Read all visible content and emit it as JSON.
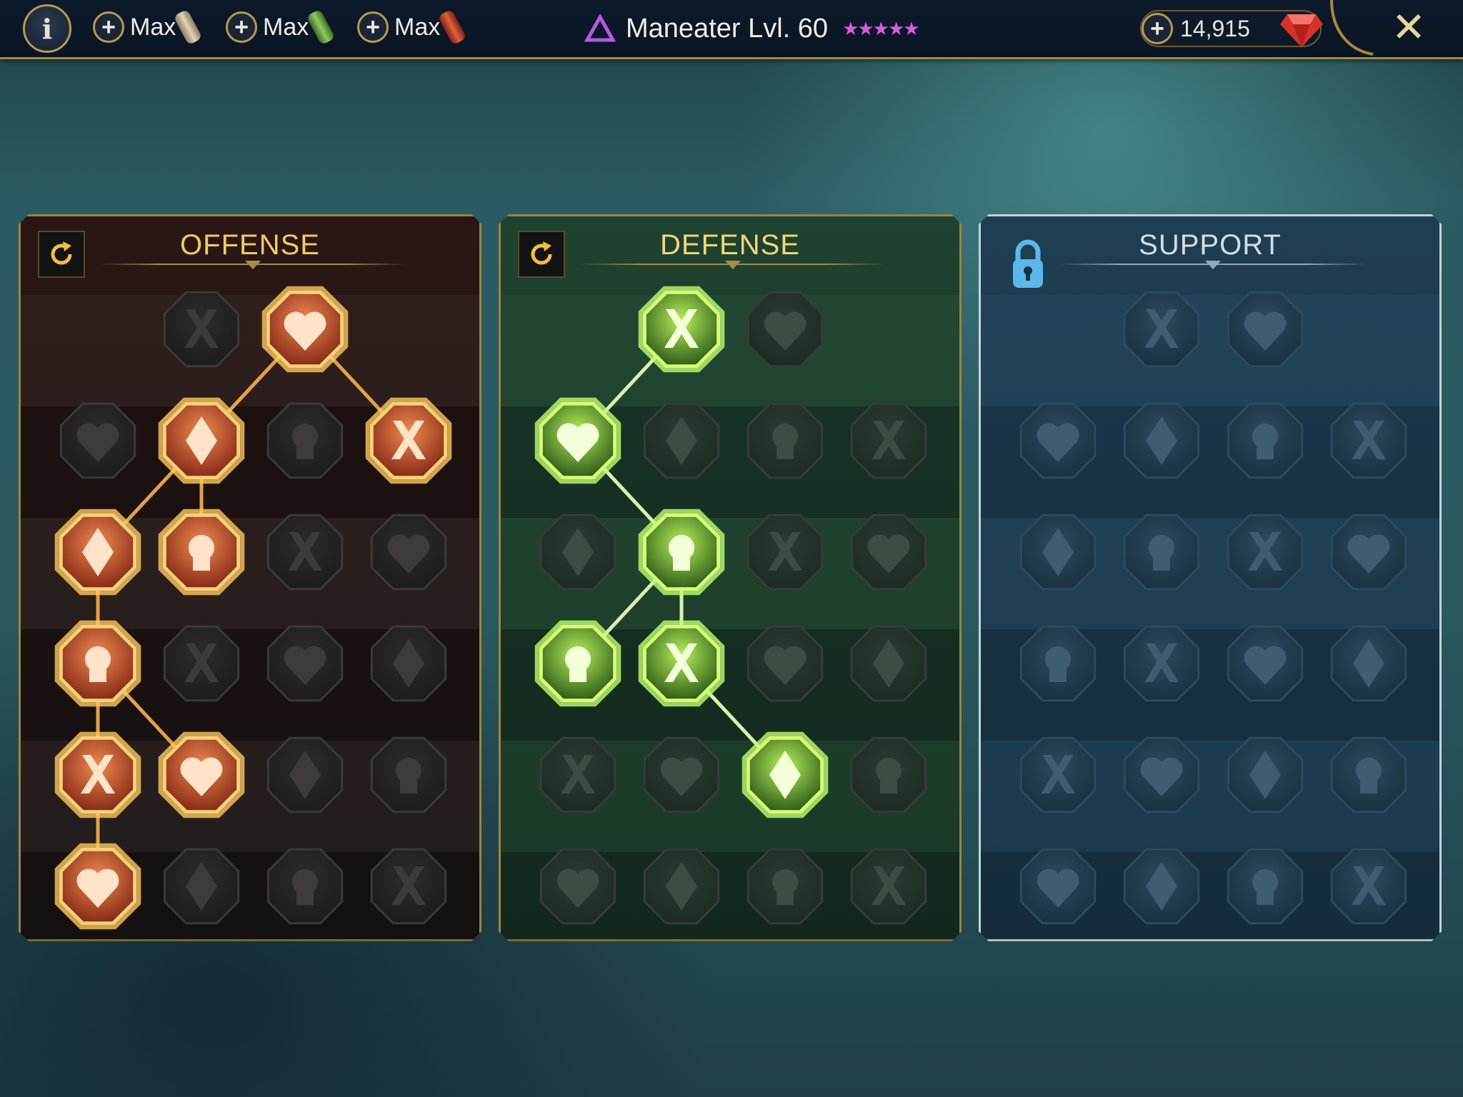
{
  "topbar": {
    "info_label": "i",
    "resources": [
      {
        "label": "Max",
        "color": "#c9b48f"
      },
      {
        "label": "Max",
        "color": "#6aa646"
      },
      {
        "label": "Max",
        "color": "#c2452d"
      }
    ],
    "champion_title": "Maneater Lvl. 60",
    "stars": "★★★★★",
    "gems": "14,915",
    "close_label": "✕"
  },
  "panels": {
    "offense": {
      "title": "OFFENSE",
      "accent": "#e0743a",
      "rows": [
        [
          {
            "icon": "crossed-swords",
            "active": false
          },
          {
            "icon": "sword-slash",
            "active": true
          }
        ],
        [
          {
            "icon": "horned-figure",
            "active": false
          },
          {
            "icon": "spear-burst",
            "active": true
          },
          {
            "icon": "shield-pierce",
            "active": false
          },
          {
            "icon": "bleeding-heart",
            "active": true
          }
        ],
        [
          {
            "icon": "arrow-volley",
            "active": true
          },
          {
            "icon": "fanged-maw",
            "active": true
          },
          {
            "icon": "skull-cloak",
            "active": false
          },
          {
            "icon": "dagger-hand",
            "active": false
          }
        ],
        [
          {
            "icon": "sword-heart",
            "active": true
          },
          {
            "icon": "fist-strike",
            "active": false
          },
          {
            "icon": "axe",
            "active": false
          },
          {
            "icon": "lightning-chain",
            "active": false
          }
        ],
        [
          {
            "icon": "triple-arrow-burst",
            "active": true
          },
          {
            "icon": "triple-skulls",
            "active": true
          },
          {
            "icon": "sword-aura",
            "active": false
          },
          {
            "icon": "flexing-figure",
            "active": false
          }
        ],
        [
          {
            "icon": "sparkling-blade",
            "active": true
          },
          {
            "icon": "knight-helm",
            "active": false
          },
          {
            "icon": "horned-demon",
            "active": false
          },
          {
            "icon": "spiked-skull",
            "active": false
          }
        ]
      ]
    },
    "defense": {
      "title": "DEFENSE",
      "accent": "#a6e03c",
      "rows": [
        [
          {
            "icon": "scale-armor",
            "active": true
          },
          {
            "icon": "raised-fist",
            "active": false
          }
        ],
        [
          {
            "icon": "chevron-shield",
            "active": true
          },
          {
            "icon": "anatomical-heart",
            "active": false
          },
          {
            "icon": "cracked-warrior",
            "active": false
          },
          {
            "icon": "crossed-blades",
            "active": false
          }
        ],
        [
          {
            "icon": "muscle-arm",
            "active": false
          },
          {
            "icon": "knight-shield",
            "active": true
          },
          {
            "icon": "skull-heart",
            "active": false
          },
          {
            "icon": "radiant-head",
            "active": false
          }
        ],
        [
          {
            "icon": "rallying-crowd",
            "active": true
          },
          {
            "icon": "skull-hourglass",
            "active": true
          },
          {
            "icon": "open-palm",
            "active": false
          },
          {
            "icon": "bull-head",
            "active": false
          }
        ],
        [
          {
            "icon": "running-figure",
            "active": false
          },
          {
            "icon": "blood-drops",
            "active": false
          },
          {
            "icon": "crowned-skull",
            "active": true
          },
          {
            "icon": "swirl-hand",
            "active": false
          }
        ],
        [
          {
            "icon": "spiked-warrior",
            "active": false
          },
          {
            "icon": "winged-shield",
            "active": false
          },
          {
            "icon": "skull-banner",
            "active": false
          },
          {
            "icon": "strongman",
            "active": false
          }
        ]
      ]
    },
    "support": {
      "title": "SUPPORT",
      "accent": "#8fb4c8",
      "rows": [
        [
          {
            "icon": "heart-plus",
            "active": false
          },
          {
            "icon": "swirl-eye",
            "active": false
          }
        ],
        [
          {
            "icon": "praying-hands",
            "active": false
          },
          {
            "icon": "shield-rings",
            "active": false
          },
          {
            "icon": "flaming-skull",
            "active": false
          },
          {
            "icon": "speed-boot",
            "active": false
          }
        ],
        [
          {
            "icon": "blessed-figure",
            "active": false
          },
          {
            "icon": "lightning-bolt",
            "active": false
          },
          {
            "icon": "broken-chain",
            "active": false
          },
          {
            "icon": "hooded-figure",
            "active": false
          }
        ],
        [
          {
            "icon": "chained-heart",
            "active": false
          },
          {
            "icon": "meteor",
            "active": false
          },
          {
            "icon": "open-book",
            "active": false
          },
          {
            "icon": "angry-eyes",
            "active": false
          }
        ],
        [
          {
            "icon": "compass-star",
            "active": false
          },
          {
            "icon": "winged-boot",
            "active": false
          },
          {
            "icon": "watchful-eye",
            "active": false
          },
          {
            "icon": "kicking-figure",
            "active": false
          }
        ],
        [
          {
            "icon": "potion-flask",
            "active": false
          },
          {
            "icon": "skull-mark",
            "active": false
          },
          {
            "icon": "fist-flames",
            "active": false
          },
          {
            "icon": "eagle-head",
            "active": false
          }
        ]
      ]
    }
  }
}
